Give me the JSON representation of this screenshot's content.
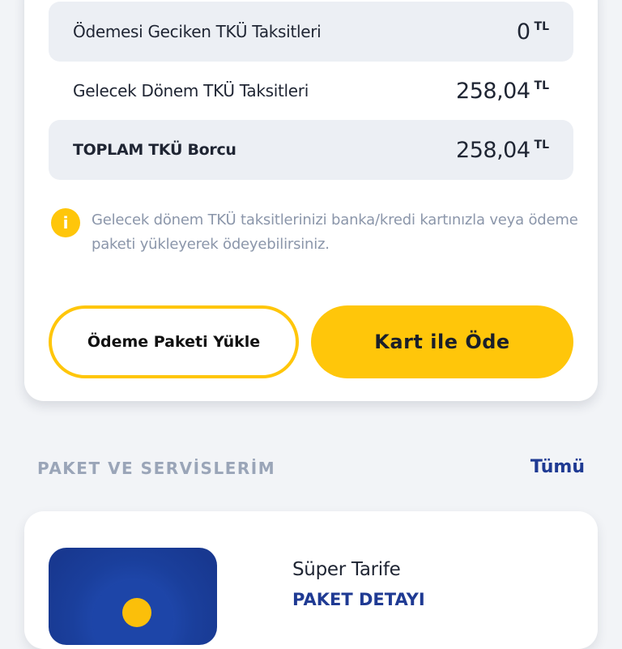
{
  "debt_summary": {
    "rows": [
      {
        "label": "Ödemesi Geciken TKÜ Taksitleri",
        "amount": "0",
        "currency": "TL"
      },
      {
        "label": "Gelecek Dönem TKÜ Taksitleri",
        "amount": "258,04",
        "currency": "TL"
      },
      {
        "label": "TOPLAM TKÜ Borcu",
        "amount": "258,04",
        "currency": "TL"
      }
    ],
    "info_icon": "i",
    "info_text": "Gelecek dönem TKÜ taksitlerinizi banka/kredi kartınızla veya ödeme paketi yükleyerek ödeyebilirsiniz.",
    "load_package_label": "Ödeme Paketi Yükle",
    "pay_by_card_label": "Kart ile Öde"
  },
  "services": {
    "title": "PAKET VE SERVİSLERİM",
    "see_all_label": "Tümü",
    "packages": [
      {
        "name": "Süper Tarife",
        "detail_label": "PAKET DETAYI"
      }
    ]
  },
  "colors": {
    "accent_yellow": "#ffc60a",
    "link_blue": "#1f3a93",
    "muted_text": "#8b96aa"
  }
}
